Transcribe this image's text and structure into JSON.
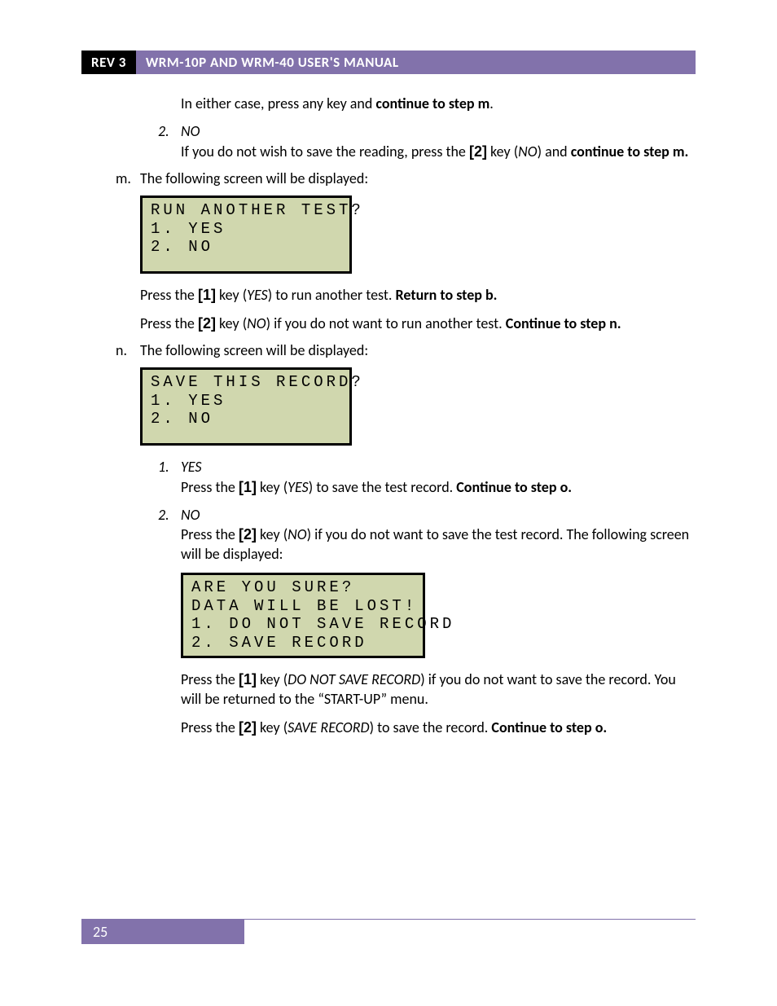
{
  "header": {
    "rev": "REV 3",
    "title": "WRM-10P AND WRM-40 USER'S MANUAL"
  },
  "intro_p1_a": "In either case, press any key and ",
  "intro_p1_b": "continue to step m",
  "intro_p1_c": ".",
  "item2": {
    "num": "2.",
    "label": "NO",
    "text_a": "If you do not wish to save the reading, press the ",
    "key": "[2]",
    "text_b": " key (",
    "ital": "NO",
    "text_c": ") and ",
    "bold": "continue to step m."
  },
  "step_m": {
    "letter": "m.",
    "text": "The following screen will be displayed:",
    "lcd": "RUN ANOTHER TEST?\n1. YES\n2. NO",
    "p1": {
      "a": "Press the ",
      "key": "[1]",
      "b": " key (",
      "ital": "YES",
      "c": ") to run another test. ",
      "bold": "Return to step b."
    },
    "p2": {
      "a": "Press the ",
      "key": "[2]",
      "b": " key (",
      "ital": "NO",
      "c": ") if you do not want to run another test. ",
      "bold": "Continue to step n."
    }
  },
  "step_n": {
    "letter": "n.",
    "text": "The following screen will be displayed:",
    "lcd": "SAVE THIS RECORD?\n1. YES\n2. NO",
    "opt1": {
      "num": "1.",
      "label": "YES",
      "a": "Press the ",
      "key": "[1]",
      "b": " key (",
      "ital": "YES",
      "c": ") to save the test record. ",
      "bold": "Continue to step o."
    },
    "opt2": {
      "num": "2.",
      "label": "NO",
      "a": "Press the ",
      "key": "[2]",
      "b": " key (",
      "ital": "NO",
      "c": ") if you do not want to save the test record. The following screen will be displayed:",
      "lcd": "ARE YOU SURE?\nDATA WILL BE LOST!\n1. DO NOT SAVE RECORD\n2. SAVE RECORD",
      "p1a": "Press the ",
      "p1key": "[1]",
      "p1b": " key (",
      "p1ital": "DO NOT SAVE RECORD",
      "p1c": ") if you do not want to save the record. You will be returned to the “START-UP” menu.",
      "p2a": "Press the ",
      "p2key": "[2]",
      "p2b": " key (",
      "p2ital": "SAVE RECORD",
      "p2c": ") to save the record. ",
      "p2bold": "Continue to step o."
    }
  },
  "footer": {
    "page": "25"
  }
}
